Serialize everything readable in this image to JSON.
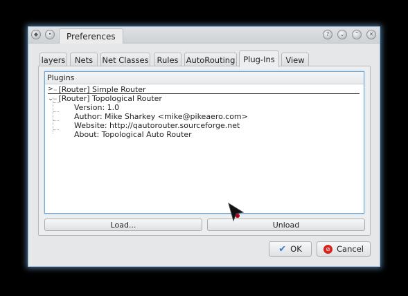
{
  "window": {
    "title": "Preferences",
    "buttons": [
      "help",
      "minimize",
      "maximize",
      "close"
    ]
  },
  "tabs": [
    {
      "label": "layers",
      "active": false
    },
    {
      "label": "Nets",
      "active": false
    },
    {
      "label": "Net Classes",
      "active": false
    },
    {
      "label": "Rules",
      "active": false
    },
    {
      "label": "AutoRouting",
      "active": false
    },
    {
      "label": "Plug-Ins",
      "active": true
    },
    {
      "label": "View",
      "active": false
    }
  ],
  "plugins": {
    "header": "Plugins",
    "items": [
      {
        "label": "[Router] Simple Router",
        "expanded": false
      },
      {
        "label": "[Router] Topological Router",
        "expanded": true,
        "children": [
          "Version: 1.0",
          "Author: Mike Sharkey <mike@pikeaero.com>",
          "Website: http://qautorouter.sourceforge.net",
          "About: Topological Auto Router"
        ]
      }
    ]
  },
  "actions": {
    "load": "Load...",
    "unload": "Unload"
  },
  "dialog": {
    "ok": "OK",
    "cancel": "Cancel"
  },
  "icons": {
    "app": "app-menu-icon",
    "pin": "pin-icon",
    "ok": "checkmark-icon",
    "cancel": "cancel-icon"
  }
}
